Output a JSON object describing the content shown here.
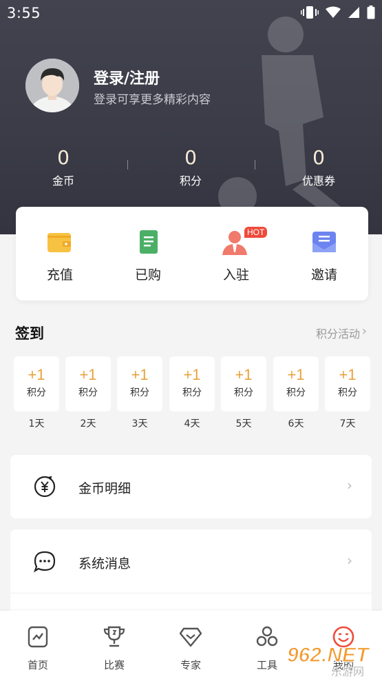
{
  "status_bar": {
    "time": "3:55"
  },
  "profile": {
    "title": "登录/注册",
    "subtitle": "登录可享更多精彩内容"
  },
  "stats": [
    {
      "value": "0",
      "label": "金币"
    },
    {
      "value": "0",
      "label": "积分"
    },
    {
      "value": "0",
      "label": "优惠券"
    }
  ],
  "quick_actions": [
    {
      "label": "充值",
      "icon": "wallet-icon"
    },
    {
      "label": "已购",
      "icon": "document-icon"
    },
    {
      "label": "入驻",
      "icon": "person-icon",
      "badge": "HOT"
    },
    {
      "label": "邀请",
      "icon": "envelope-icon"
    }
  ],
  "signin": {
    "title": "签到",
    "more_label": "积分活动",
    "days": [
      {
        "points": "+1",
        "unit": "积分",
        "day": "1天"
      },
      {
        "points": "+1",
        "unit": "积分",
        "day": "2天"
      },
      {
        "points": "+1",
        "unit": "积分",
        "day": "3天"
      },
      {
        "points": "+1",
        "unit": "积分",
        "day": "4天"
      },
      {
        "points": "+1",
        "unit": "积分",
        "day": "5天"
      },
      {
        "points": "+1",
        "unit": "积分",
        "day": "6天"
      },
      {
        "points": "+1",
        "unit": "积分",
        "day": "7天"
      }
    ]
  },
  "menu": [
    {
      "label": "金币明细",
      "icon": "coin-icon"
    },
    {
      "label": "系统消息",
      "icon": "message-icon"
    }
  ],
  "nav": [
    {
      "label": "首页",
      "icon": "home-chart-icon"
    },
    {
      "label": "比赛",
      "icon": "trophy-icon"
    },
    {
      "label": "专家",
      "icon": "diamond-icon"
    },
    {
      "label": "工具",
      "icon": "tools-icon"
    },
    {
      "label": "我的",
      "icon": "smile-icon"
    }
  ],
  "watermark": {
    "text": "962.NET",
    "subtext": "乐游网"
  },
  "colors": {
    "accent": "#e9a23b",
    "hero": "#3b3c48",
    "hot": "#ee4b3b",
    "nav_active": "#ee4b3b"
  }
}
